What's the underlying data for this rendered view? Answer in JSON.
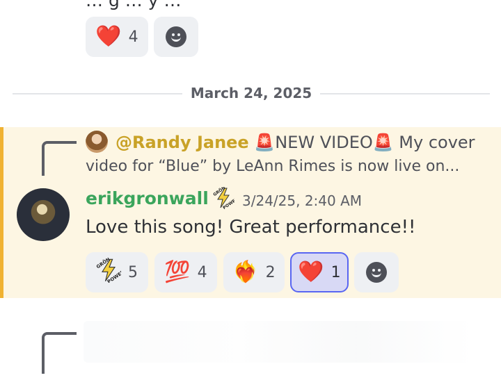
{
  "top_message": {
    "partial_text": "… g … y …"
  },
  "top_reactions": [
    {
      "icon": "heart-emoji",
      "emoji": "❤️",
      "count": "4"
    },
    {
      "icon": "add-reaction-icon"
    }
  ],
  "date_divider": "March 24, 2025",
  "reply": {
    "mention": "@Randy Janee",
    "line1_a": "NEW VIDEO",
    "line1_b": "My cover",
    "line2": "video for “Blue” by LeAnn Rimes is now live on...",
    "siren_emoji": "🚨"
  },
  "message": {
    "author": "erikgronwall",
    "timestamp": "3/24/25, 2:40 AM",
    "body": "Love this song! Great performance!!"
  },
  "reactions": [
    {
      "icon": "gronwall-power-emoji",
      "count": "5",
      "selected": false
    },
    {
      "icon": "hundred-points-emoji",
      "emoji": "💯",
      "count": "4",
      "selected": false
    },
    {
      "icon": "heart-on-fire-emoji",
      "emoji": "❤️‍🔥",
      "count": "2",
      "selected": false
    },
    {
      "icon": "heart-emoji",
      "emoji": "❤️",
      "count": "1",
      "selected": true
    },
    {
      "icon": "add-reaction-icon"
    }
  ],
  "colors": {
    "highlight_bg": "#fdf6e3",
    "highlight_bar": "#f0b232",
    "mention": "#c9a227",
    "author": "#3ba55c",
    "selected_reaction_bg": "#d8d9f5",
    "selected_reaction_border": "#5865f2"
  }
}
